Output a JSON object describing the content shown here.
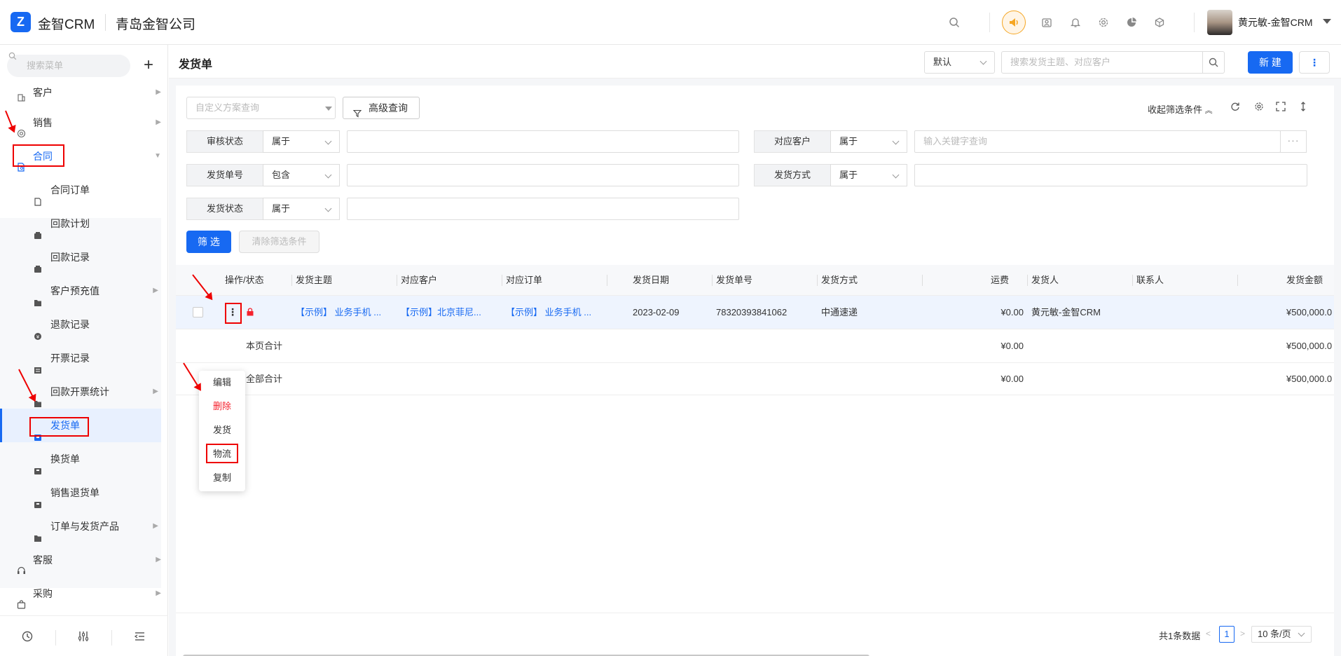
{
  "topbar": {
    "logo_mark": "Z",
    "brand": "金智CRM",
    "company": "青岛金智公司",
    "user_name": "黄元敏-金智CRM",
    "icons": [
      "search-icon",
      "speaker-icon",
      "contacts-icon",
      "bell-icon",
      "gear-icon",
      "pie-chart-icon",
      "cube-icon"
    ]
  },
  "sidebar": {
    "search_placeholder": "搜索菜单",
    "add_label": "+",
    "items": [
      {
        "label": "客户",
        "icon": "building-icon"
      },
      {
        "label": "销售",
        "icon": "target-icon"
      },
      {
        "label": "合同",
        "icon": "contract-icon"
      }
    ],
    "sub_items": [
      {
        "label": "合同订单"
      },
      {
        "label": "回款计划"
      },
      {
        "label": "回款记录"
      },
      {
        "label": "客户预充值"
      },
      {
        "label": "退款记录"
      },
      {
        "label": "开票记录"
      },
      {
        "label": "回款开票统计"
      },
      {
        "label": "发货单"
      },
      {
        "label": "换货单"
      },
      {
        "label": "销售退货单"
      },
      {
        "label": "订单与发货产品"
      }
    ],
    "bottom_items": [
      {
        "label": "客服"
      },
      {
        "label": "采购"
      }
    ]
  },
  "page": {
    "title": "发货单",
    "view_select": "默认",
    "search_placeholder": "搜索发货主题、对应客户",
    "new_label": "新 建",
    "more_label": "⋮"
  },
  "filters": {
    "scheme_placeholder": "自定义方案查询",
    "advanced_label": "高级查询",
    "collapse_label": "收起筛选条件",
    "rows": [
      {
        "label": "审核状态",
        "op": "属于",
        "value": ""
      },
      {
        "label": "对应客户",
        "op": "属于",
        "value": "输入关键字查询"
      },
      {
        "label": "发货单号",
        "op": "包含",
        "value": ""
      },
      {
        "label": "发货方式",
        "op": "属于",
        "value": ""
      },
      {
        "label": "发货状态",
        "op": "属于",
        "value": ""
      }
    ],
    "dots_label": "···",
    "filter_btn": "筛 选",
    "clear_btn": "清除筛选条件"
  },
  "table": {
    "columns": [
      "操作/状态",
      "发货主题",
      "对应客户",
      "对应订单",
      "发货日期",
      "发货单号",
      "发货方式",
      "运费",
      "发货人",
      "联系人",
      "发货金额"
    ],
    "row": {
      "subject": "【示例】 业务手机 ...",
      "customer": "【示例】北京菲尼...",
      "order": "【示例】 业务手机 ...",
      "date": "2023-02-09",
      "number": "78320393841062",
      "method": "中通速递",
      "freight": "¥0.00",
      "shipper": "黄元敏-金智CRM",
      "contact": "",
      "amount": "¥500,000.0"
    },
    "page_total": {
      "label": "本页合计",
      "freight": "¥0.00",
      "amount": "¥500,000.0"
    },
    "all_total": {
      "label": "全部合计",
      "freight": "¥0.00",
      "amount": "¥500,000.0"
    }
  },
  "dropdown": {
    "items": [
      {
        "label": "编辑"
      },
      {
        "label": "删除"
      },
      {
        "label": "发货"
      },
      {
        "label": "物流"
      },
      {
        "label": "复制"
      }
    ]
  },
  "pagination": {
    "total": "共1条数据",
    "prev": "<",
    "next": ">",
    "current": "1",
    "page_size": "10 条/页"
  },
  "colors": {
    "primary": "#1769f2",
    "danger": "#f5222d",
    "annotation": "#ee0000",
    "speaker": "#f5a623"
  }
}
